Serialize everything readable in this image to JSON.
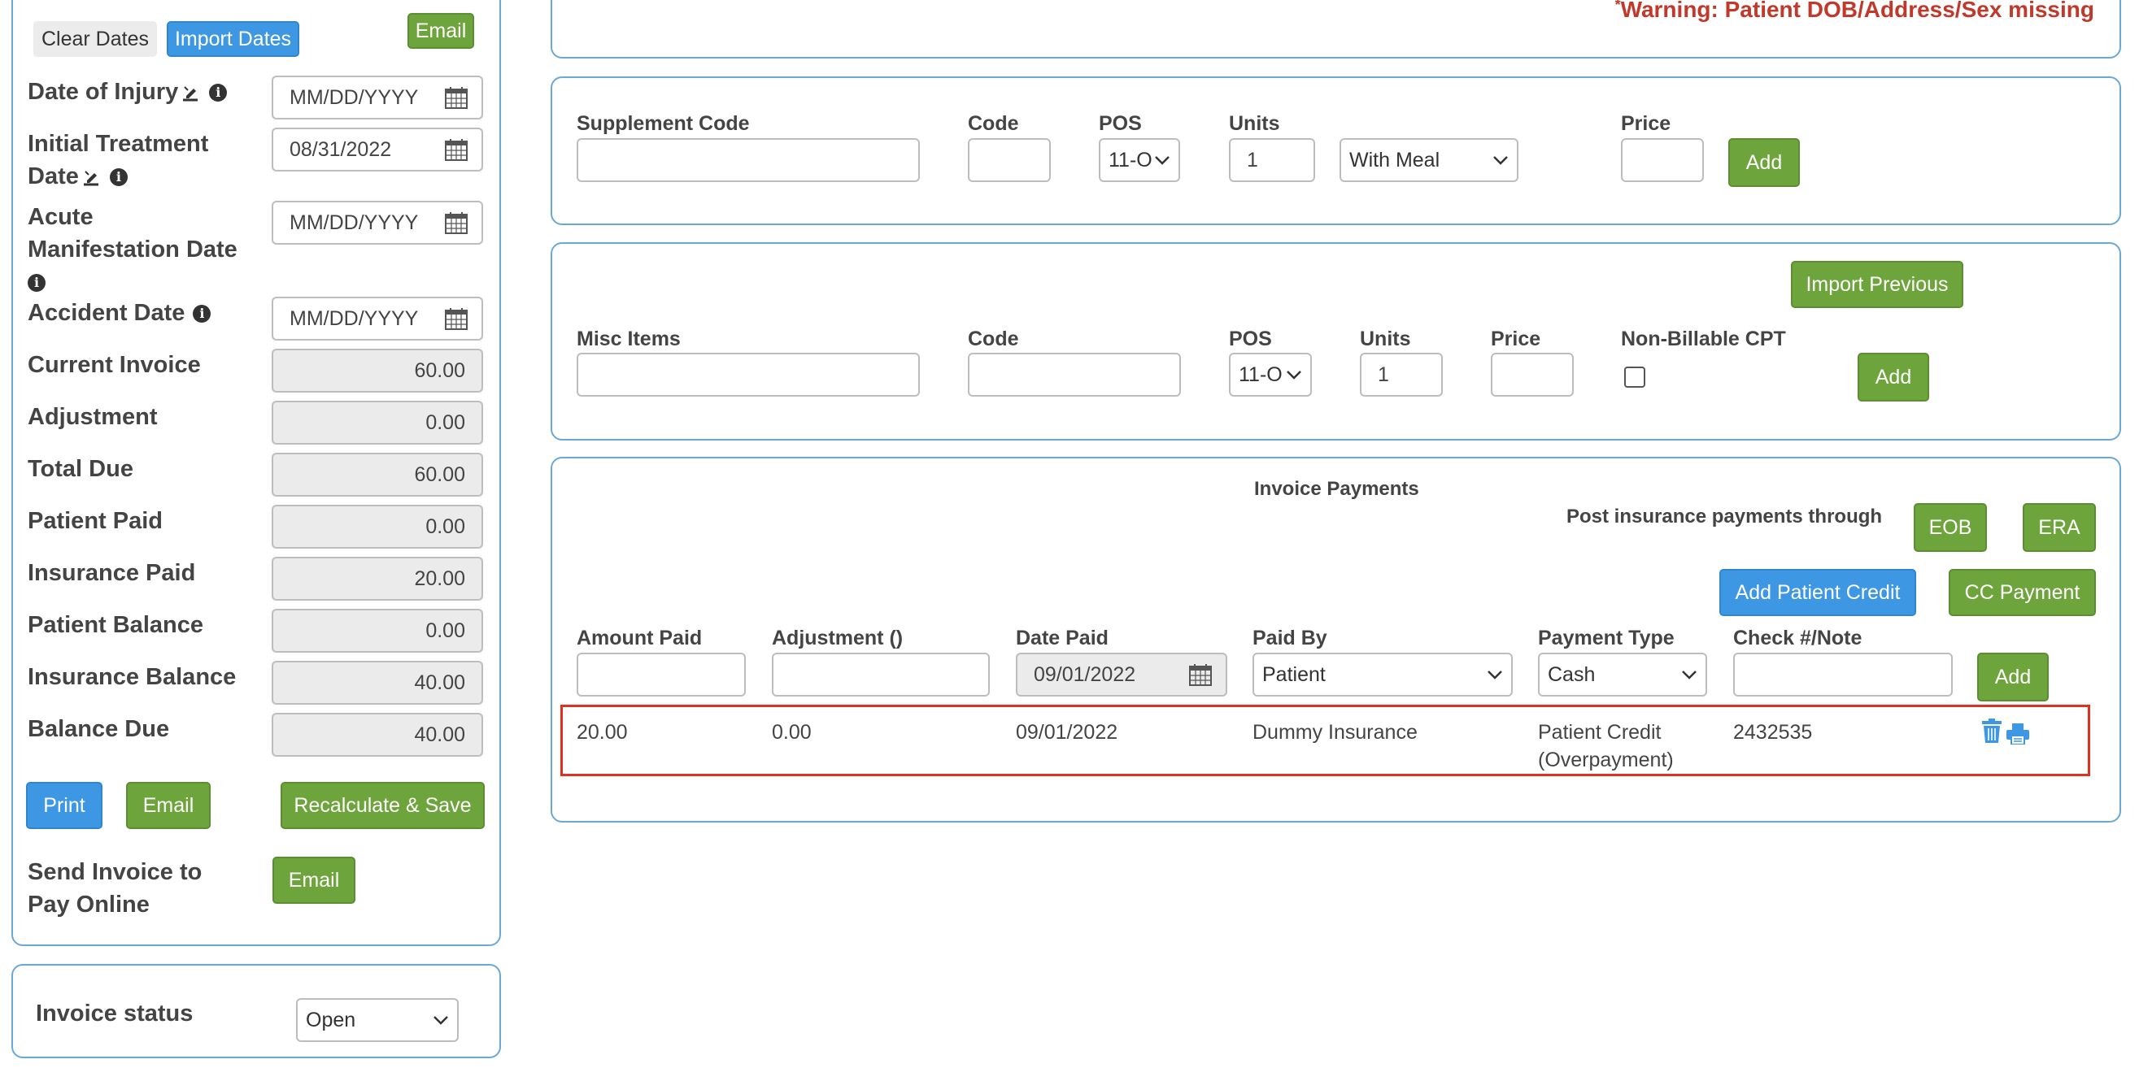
{
  "warning": "Warning: Patient DOB/Address/Sex missing",
  "warning_prefix": "*",
  "colors": {
    "accent_green": "#6ea43c",
    "accent_blue": "#3d97e3",
    "warning_red": "#c0392b",
    "panel_border": "#6aa8d8",
    "highlight_border": "#e0311f"
  },
  "sidebar": {
    "clear_dates": "Clear Dates",
    "import_dates": "Import Dates",
    "email_top": "Email",
    "date_of_injury_label": "Date of Injury",
    "date_of_injury_value": "MM/DD/YYYY",
    "initial_treatment_label_1": "Initial Treatment",
    "initial_treatment_label_2": "Date",
    "initial_treatment_value": "08/31/2022",
    "acute_label_1": "Acute",
    "acute_label_2": "Manifestation Date",
    "acute_value": "MM/DD/YYYY",
    "accident_label": "Accident Date",
    "accident_value": "MM/DD/YYYY",
    "fields": [
      {
        "label": "Current Invoice",
        "value": "60.00"
      },
      {
        "label": "Adjustment",
        "value": "0.00"
      },
      {
        "label": "Total Due",
        "value": "60.00"
      },
      {
        "label": "Patient Paid",
        "value": "0.00"
      },
      {
        "label": "Insurance Paid",
        "value": "20.00"
      },
      {
        "label": "Patient Balance",
        "value": "0.00"
      },
      {
        "label": "Insurance Balance",
        "value": "40.00"
      },
      {
        "label": "Balance Due",
        "value": "40.00"
      }
    ],
    "print": "Print",
    "email": "Email",
    "recalculate": "Recalculate & Save",
    "send_invoice_1": "Send Invoice to",
    "send_invoice_2": "Pay Online",
    "send_email": "Email",
    "invoice_status_label": "Invoice status",
    "invoice_status_value": "Open"
  },
  "supplement": {
    "code_label": "Supplement Code",
    "code2_label": "Code",
    "pos_label": "POS",
    "pos_value": "11-O",
    "units_label": "Units",
    "units_value": "1",
    "meal_value": "With Meal",
    "price_label": "Price",
    "add": "Add"
  },
  "misc": {
    "import_previous": "Import Previous",
    "items_label": "Misc Items",
    "code_label": "Code",
    "pos_label": "POS",
    "pos_value": "11-O",
    "units_label": "Units",
    "units_value": "1",
    "price_label": "Price",
    "nonbillable_label": "Non-Billable CPT",
    "add": "Add"
  },
  "payments": {
    "title": "Invoice Payments",
    "post_through": "Post insurance payments through",
    "eob": "EOB",
    "era": "ERA",
    "add_patient_credit": "Add Patient Credit",
    "cc_payment": "CC Payment",
    "headers": {
      "amount_paid": "Amount Paid",
      "adjustment": "Adjustment ()",
      "date_paid": "Date Paid",
      "paid_by": "Paid By",
      "payment_type": "Payment Type",
      "check_note": "Check #/Note"
    },
    "date_paid_value": "09/01/2022",
    "paid_by_value": "Patient",
    "payment_type_value": "Cash",
    "add": "Add",
    "row": {
      "amount": "20.00",
      "adjustment": "0.00",
      "date": "09/01/2022",
      "paid_by": "Dummy Insurance",
      "type_1": "Patient Credit",
      "type_2": "(Overpayment)",
      "note": "2432535"
    }
  }
}
